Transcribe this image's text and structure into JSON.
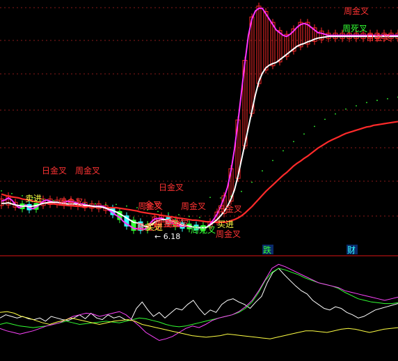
{
  "chart_data": [
    {
      "type": "line",
      "subtype": "candlestick",
      "x": [
        1,
        2,
        3,
        4,
        5,
        6,
        7,
        8,
        9,
        10,
        11,
        12,
        13,
        14,
        15,
        16,
        17,
        18,
        19,
        20,
        21,
        22,
        23,
        24,
        25,
        26,
        27,
        28,
        29,
        30,
        31,
        32,
        33,
        34,
        35,
        36,
        37,
        38,
        39,
        40,
        41,
        42,
        43,
        44,
        45,
        46,
        47,
        48,
        49,
        50,
        51,
        52,
        53,
        54,
        55,
        56,
        57,
        58,
        59,
        60,
        61,
        62,
        63,
        64,
        65,
        66,
        67,
        68,
        69,
        70,
        71,
        72,
        73,
        74,
        75,
        76,
        77,
        78,
        79,
        80,
        81,
        82,
        83,
        84,
        85,
        86,
        87,
        88,
        89,
        90,
        91,
        92,
        93,
        94,
        95,
        96,
        97,
        98,
        99,
        100,
        101,
        102,
        103,
        104,
        105,
        106,
        107,
        108,
        109,
        110,
        111,
        112,
        113,
        114,
        115
      ],
      "min_price_label": "← 6.18",
      "min_price": 6.18,
      "series": [
        {
          "key": "ma_red",
          "color": "#ff2a2a",
          "values": [
            6.97,
            6.95,
            6.93,
            6.92,
            6.91,
            6.9,
            6.88,
            6.87,
            6.86,
            6.84,
            6.83,
            6.82,
            6.81,
            6.8,
            6.79,
            6.79,
            6.78,
            6.77,
            6.77,
            6.76,
            6.76,
            6.75,
            6.75,
            6.74,
            6.74,
            6.74,
            6.74,
            6.73,
            6.73,
            6.73,
            6.72,
            6.72,
            6.72,
            6.72,
            6.71,
            6.7,
            6.69,
            6.68,
            6.67,
            6.66,
            6.64,
            6.63,
            6.62,
            6.61,
            6.6,
            6.59,
            6.58,
            6.57,
            6.56,
            6.55,
            6.54,
            6.53,
            6.52,
            6.51,
            6.5,
            6.49,
            6.49,
            6.48,
            6.47,
            6.46,
            6.46,
            6.45,
            6.45,
            6.45,
            6.45,
            6.46,
            6.48,
            6.5,
            6.53,
            6.57,
            6.62,
            6.68,
            6.74,
            6.81,
            6.88,
            6.95,
            7.02,
            7.08,
            7.14,
            7.2,
            7.26,
            7.32,
            7.37,
            7.43,
            7.49,
            7.54,
            7.58,
            7.63,
            7.67,
            7.72,
            7.77,
            7.82,
            7.86,
            7.9,
            7.94,
            7.97,
            8.0,
            8.03,
            8.06,
            8.09,
            8.11,
            8.13,
            8.15,
            8.17,
            8.19,
            8.21,
            8.22,
            8.24,
            8.25,
            8.26,
            8.27,
            8.28,
            8.29,
            8.3,
            8.31
          ]
        },
        {
          "key": "ma_white",
          "color": "#ffffff",
          "values": [
            6.8,
            6.8,
            6.81,
            6.79,
            6.77,
            6.76,
            6.75,
            6.75,
            6.74,
            6.75,
            6.76,
            6.78,
            6.8,
            6.81,
            6.82,
            6.82,
            6.82,
            6.81,
            6.8,
            6.79,
            6.79,
            6.79,
            6.78,
            6.77,
            6.76,
            6.76,
            6.75,
            6.74,
            6.74,
            6.73,
            6.71,
            6.69,
            6.67,
            6.64,
            6.61,
            6.57,
            6.53,
            6.49,
            6.45,
            6.44,
            6.42,
            6.38,
            6.37,
            6.4,
            6.45,
            6.48,
            6.5,
            6.5,
            6.5,
            6.48,
            6.45,
            6.42,
            6.4,
            6.39,
            6.38,
            6.37,
            6.36,
            6.35,
            6.35,
            6.36,
            6.4,
            6.45,
            6.5,
            6.57,
            6.65,
            6.75,
            6.88,
            7.05,
            7.3,
            7.6,
            7.9,
            8.2,
            8.5,
            8.8,
            9.05,
            9.2,
            9.3,
            9.35,
            9.38,
            9.4,
            9.45,
            9.5,
            9.55,
            9.6,
            9.65,
            9.7,
            9.73,
            9.75,
            9.78,
            9.8,
            9.83,
            9.85,
            9.86,
            9.87,
            9.88,
            9.88,
            9.88,
            9.88,
            9.88,
            9.88,
            9.88,
            9.88,
            9.88,
            9.88,
            9.88,
            9.88,
            9.88,
            9.88,
            9.88,
            9.88,
            9.88,
            9.88,
            9.88,
            9.88,
            9.88
          ]
        },
        {
          "key": "ma_magenta",
          "color": "#ff33ff",
          "values": [
            6.84,
            6.86,
            6.9,
            6.86,
            6.78,
            6.72,
            6.74,
            6.77,
            6.72,
            6.7,
            6.73,
            6.78,
            6.84,
            6.86,
            6.84,
            6.82,
            6.82,
            6.8,
            6.82,
            6.84,
            6.83,
            6.82,
            6.8,
            6.79,
            6.78,
            6.76,
            6.75,
            6.75,
            6.75,
            6.75,
            6.72,
            6.67,
            6.63,
            6.58,
            6.54,
            6.47,
            6.42,
            6.38,
            6.34,
            6.33,
            6.34,
            6.32,
            6.35,
            6.45,
            6.51,
            6.52,
            6.53,
            6.5,
            6.47,
            6.44,
            6.41,
            6.39,
            6.38,
            6.38,
            6.37,
            6.36,
            6.35,
            6.35,
            6.34,
            6.36,
            6.42,
            6.5,
            6.6,
            6.74,
            6.9,
            7.1,
            7.4,
            7.8,
            8.3,
            8.85,
            9.4,
            9.9,
            10.2,
            10.35,
            10.4,
            10.4,
            10.3,
            10.2,
            10.1,
            10.0,
            9.95,
            9.9,
            9.88,
            9.92,
            9.98,
            10.05,
            10.1,
            10.12,
            10.1,
            10.05,
            10.0,
            9.95,
            9.94,
            9.92,
            9.9,
            9.9,
            9.9,
            9.9,
            9.9,
            9.9,
            9.9,
            9.9,
            9.9,
            9.9,
            9.9,
            9.9,
            9.9,
            9.9,
            9.9,
            9.9,
            9.9,
            9.9,
            9.9,
            9.9,
            9.9
          ]
        }
      ],
      "annotations": [
        "日金叉",
        "周金叉",
        "周金叉",
        "卖进",
        "日金叉",
        "周金叉",
        "金叉",
        "金叉",
        "周金叉",
        "买进",
        "周金叉",
        "周金叉",
        "周死叉",
        "周金叉",
        "日金叉",
        "周金叉",
        "买进",
        "周金叉",
        "周死叉",
        "日金叉"
      ]
    },
    {
      "type": "line",
      "labels": [
        "跌",
        "财"
      ],
      "series": [
        {
          "key": "osc_white",
          "color": "#ffffff",
          "values": [
            0.38,
            0.42,
            0.4,
            0.38,
            0.4,
            0.37,
            0.36,
            0.38,
            0.34,
            0.4,
            0.38,
            0.36,
            0.35,
            0.38,
            0.42,
            0.37,
            0.44,
            0.38,
            0.36,
            0.42,
            0.38,
            0.4,
            0.36,
            0.35,
            0.5,
            0.58,
            0.48,
            0.4,
            0.45,
            0.38,
            0.44,
            0.5,
            0.48,
            0.55,
            0.6,
            0.5,
            0.42,
            0.48,
            0.45,
            0.55,
            0.6,
            0.62,
            0.58,
            0.55,
            0.5,
            0.58,
            0.65,
            0.82,
            0.95,
            1.0,
            0.92,
            0.85,
            0.78,
            0.72,
            0.68,
            0.6,
            0.55,
            0.5,
            0.48,
            0.52,
            0.5,
            0.45,
            0.42,
            0.38,
            0.4,
            0.44,
            0.48,
            0.5,
            0.52,
            0.54,
            0.56
          ]
        },
        {
          "key": "osc_green",
          "color": "#33ff33",
          "values": [
            0.3,
            0.32,
            0.3,
            0.28,
            0.27,
            0.26,
            0.27,
            0.28,
            0.3,
            0.32,
            0.34,
            0.32,
            0.3,
            0.31,
            0.32,
            0.33,
            0.34,
            0.33,
            0.32,
            0.34,
            0.36,
            0.38,
            0.37,
            0.35,
            0.33,
            0.3,
            0.28,
            0.27,
            0.28,
            0.3,
            0.32,
            0.34,
            0.36,
            0.38,
            0.4,
            0.42,
            0.45,
            0.5,
            0.58,
            0.7,
            0.85,
            0.95,
            1.0,
            0.98,
            0.95,
            0.92,
            0.88,
            0.85,
            0.82,
            0.8,
            0.78,
            0.75,
            0.7,
            0.66,
            0.62,
            0.6,
            0.58,
            0.57,
            0.56,
            0.56,
            0.57
          ]
        },
        {
          "key": "osc_magenta",
          "color": "#ff44ff",
          "values": [
            0.25,
            0.22,
            0.2,
            0.18,
            0.2,
            0.22,
            0.25,
            0.28,
            0.3,
            0.32,
            0.36,
            0.4,
            0.42,
            0.44,
            0.43,
            0.4,
            0.42,
            0.44,
            0.46,
            0.42,
            0.35,
            0.28,
            0.2,
            0.15,
            0.1,
            0.12,
            0.15,
            0.2,
            0.25,
            0.28,
            0.26,
            0.3,
            0.35,
            0.38,
            0.4,
            0.42,
            0.46,
            0.52,
            0.6,
            0.72,
            0.86,
            1.0,
            1.05,
            1.02,
            0.98,
            0.94,
            0.9,
            0.86,
            0.82,
            0.8,
            0.78,
            0.76,
            0.72,
            0.7,
            0.68,
            0.66,
            0.64,
            0.62,
            0.6,
            0.62,
            0.64
          ]
        },
        {
          "key": "osc_yellow",
          "color": "#ffff44",
          "values": [
            0.45,
            0.46,
            0.44,
            0.4,
            0.38,
            0.35,
            0.32,
            0.3,
            0.33,
            0.35,
            0.38,
            0.36,
            0.34,
            0.32,
            0.3,
            0.32,
            0.34,
            0.35,
            0.36,
            0.34,
            0.3,
            0.28,
            0.26,
            0.24,
            0.22,
            0.2,
            0.18,
            0.16,
            0.15,
            0.14,
            0.15,
            0.16,
            0.18,
            0.17,
            0.16,
            0.15,
            0.14,
            0.13,
            0.12,
            0.14,
            0.16,
            0.18,
            0.2,
            0.22,
            0.22,
            0.21,
            0.2,
            0.22,
            0.24,
            0.25,
            0.24,
            0.22,
            0.2,
            0.22,
            0.24,
            0.25,
            0.26
          ]
        }
      ]
    }
  ]
}
